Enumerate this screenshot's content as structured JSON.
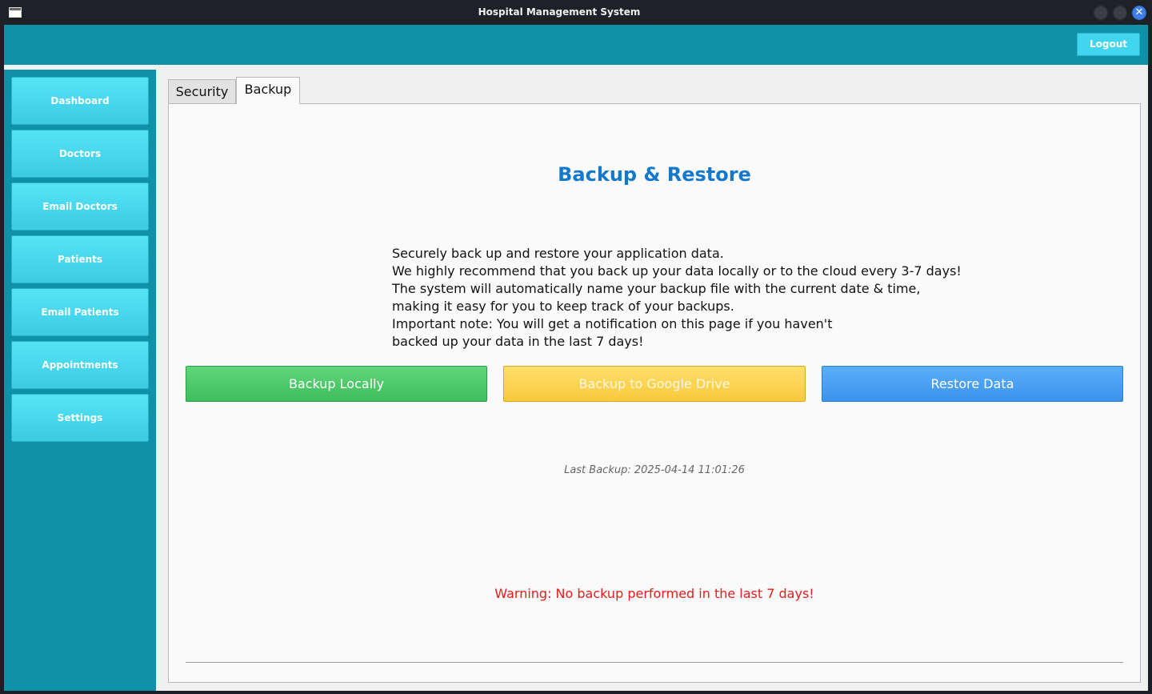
{
  "window": {
    "title": "Hospital Management System",
    "app_icon": "window-icon",
    "controls": [
      "minimize-icon",
      "maximize-icon",
      "close-icon"
    ],
    "close_glyph": "✕"
  },
  "header": {
    "logout_label": "Logout",
    "background": "#0f91aa"
  },
  "sidebar": {
    "items": [
      {
        "label": "Dashboard"
      },
      {
        "label": "Doctors"
      },
      {
        "label": "Email Doctors"
      },
      {
        "label": "Patients"
      },
      {
        "label": "Email Patients"
      },
      {
        "label": "Appointments"
      },
      {
        "label": "Settings"
      }
    ]
  },
  "tabs": [
    {
      "label": "Security",
      "active": false
    },
    {
      "label": "Backup",
      "active": true
    }
  ],
  "backup": {
    "heading": "Backup & Restore",
    "description_lines": [
      "Securely back up and restore your application data.",
      "We highly recommend that you back up your data locally or to the cloud every 3-7 days!",
      "The system will automatically name your backup file with the current date & time,",
      "making it easy for you to keep track of your backups.",
      "Important note: You will get a notification on this page if you haven't",
      "backed up your data in the last 7 days!"
    ],
    "buttons": {
      "local": "Backup Locally",
      "drive": "Backup to Google Drive",
      "restore": "Restore Data"
    },
    "last_backup": "Last Backup: 2025-04-14 11:01:26",
    "warning": "Warning: No backup performed in the last 7 days!"
  },
  "colors": {
    "accent": "#0f91aa",
    "heading": "#1479cc",
    "warning": "#e61b1b",
    "local_button": "#4cc868",
    "drive_button": "#fbd24f",
    "restore_button": "#4aa0f2"
  }
}
